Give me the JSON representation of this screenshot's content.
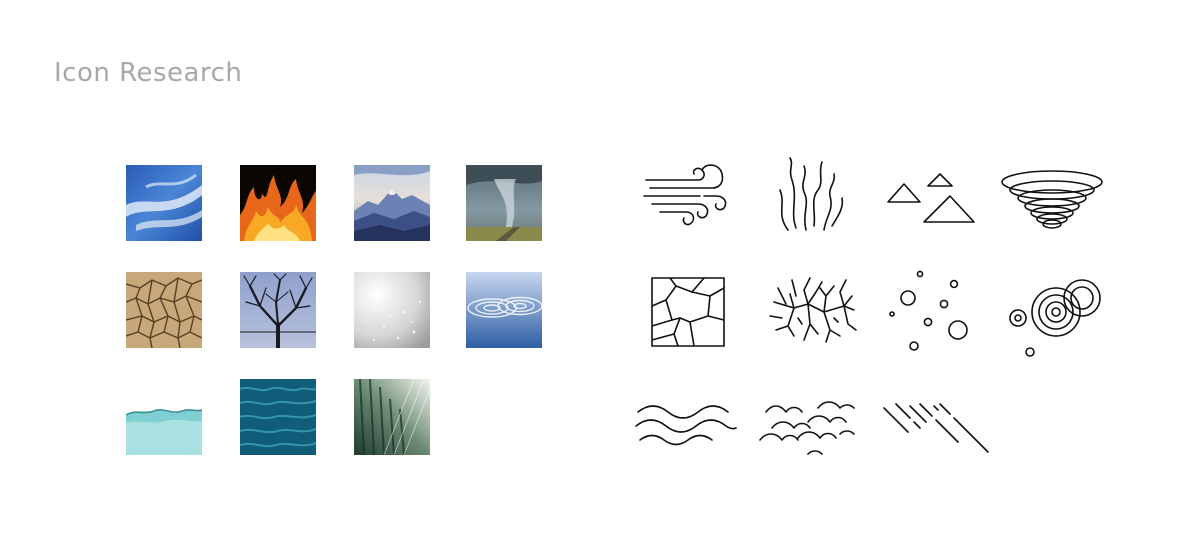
{
  "title": "Icon Research",
  "photos": [
    "wind-clouds",
    "fire",
    "mountains",
    "tornado",
    "cracked-earth",
    "bare-tree",
    "frost",
    "water-ripples",
    "water-surface",
    "ocean-waves",
    "rain-forest"
  ],
  "icons": [
    "wind-icon",
    "fire-icon",
    "mountains-icon",
    "tornado-icon",
    "cracked-earth-icon",
    "branches-icon",
    "bubbles-icon",
    "ripples-icon",
    "waves-icon",
    "clouds-icon",
    "rain-icon"
  ],
  "colors": {
    "title": "#a8a8a8",
    "background": "#ffffff",
    "icon_stroke": "#111111"
  }
}
